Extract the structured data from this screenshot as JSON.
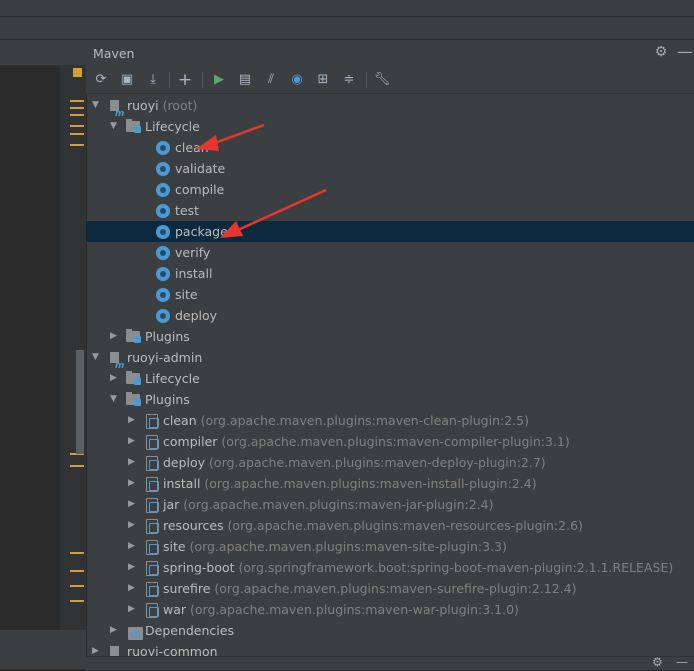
{
  "panel": {
    "title": "Maven"
  },
  "tree": [
    {
      "label": "ruoyi",
      "sub": "(root)",
      "kind": "project",
      "arrow": "down",
      "level": 0
    },
    {
      "label": "Lifecycle",
      "kind": "folder",
      "arrow": "down",
      "level": 1
    },
    {
      "label": "clean",
      "kind": "goal",
      "level": 2
    },
    {
      "label": "validate",
      "kind": "goal",
      "level": 2
    },
    {
      "label": "compile",
      "kind": "goal",
      "level": 2
    },
    {
      "label": "test",
      "kind": "goal",
      "level": 2
    },
    {
      "label": "package",
      "kind": "goal",
      "level": 2,
      "selected": true
    },
    {
      "label": "verify",
      "kind": "goal",
      "level": 2
    },
    {
      "label": "install",
      "kind": "goal",
      "level": 2
    },
    {
      "label": "site",
      "kind": "goal",
      "level": 2
    },
    {
      "label": "deploy",
      "kind": "goal",
      "level": 2
    },
    {
      "label": "Plugins",
      "kind": "folder",
      "arrow": "right",
      "level": 1
    },
    {
      "label": "ruoyi-admin",
      "kind": "project",
      "arrow": "down",
      "level": 0
    },
    {
      "label": "Lifecycle",
      "kind": "folder",
      "arrow": "right",
      "level": 1
    },
    {
      "label": "Plugins",
      "kind": "folder",
      "arrow": "down",
      "level": 1
    },
    {
      "label": "clean",
      "sub": "(org.apache.maven.plugins:maven-clean-plugin:2.5)",
      "kind": "plugin",
      "arrow": "right",
      "level": 2
    },
    {
      "label": "compiler",
      "sub": "(org.apache.maven.plugins:maven-compiler-plugin:3.1)",
      "kind": "plugin",
      "arrow": "right",
      "level": 2
    },
    {
      "label": "deploy",
      "sub": "(org.apache.maven.plugins:maven-deploy-plugin:2.7)",
      "kind": "plugin",
      "arrow": "right",
      "level": 2
    },
    {
      "label": "install",
      "sub": "(org.apache.maven.plugins:maven-install-plugin:2.4)",
      "kind": "plugin",
      "arrow": "right",
      "level": 2
    },
    {
      "label": "jar",
      "sub": "(org.apache.maven.plugins:maven-jar-plugin:2.4)",
      "kind": "plugin",
      "arrow": "right",
      "level": 2
    },
    {
      "label": "resources",
      "sub": "(org.apache.maven.plugins:maven-resources-plugin:2.6)",
      "kind": "plugin",
      "arrow": "right",
      "level": 2
    },
    {
      "label": "site",
      "sub": "(org.apache.maven.plugins:maven-site-plugin:3.3)",
      "kind": "plugin",
      "arrow": "right",
      "level": 2
    },
    {
      "label": "spring-boot",
      "sub": "(org.springframework.boot:spring-boot-maven-plugin:2.1.1.RELEASE)",
      "kind": "plugin",
      "arrow": "right",
      "level": 2
    },
    {
      "label": "surefire",
      "sub": "(org.apache.maven.plugins:maven-surefire-plugin:2.12.4)",
      "kind": "plugin",
      "arrow": "right",
      "level": 2
    },
    {
      "label": "war",
      "sub": "(org.apache.maven.plugins:maven-war-plugin:3.1.0)",
      "kind": "plugin",
      "arrow": "right",
      "level": 2
    },
    {
      "label": "Dependencies",
      "kind": "deps",
      "arrow": "right",
      "level": 1
    },
    {
      "label": "ruoyi-common",
      "kind": "project",
      "arrow": "right",
      "level": 0
    }
  ],
  "colors": {
    "selection": "#0d293e",
    "goal_icon": "#4a9ad6",
    "annotation_arrow": "#e8362e"
  }
}
